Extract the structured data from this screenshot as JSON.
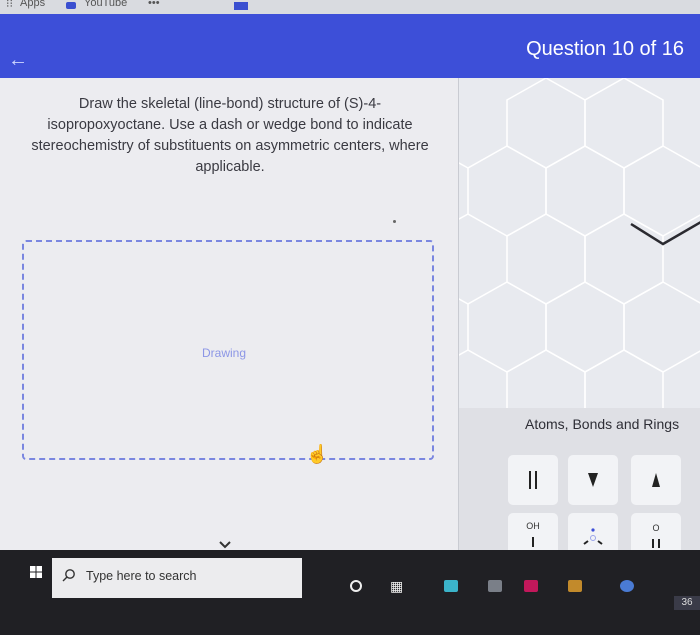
{
  "browser": {
    "bookmarks": [
      "Apps",
      "YouTube",
      "•••"
    ]
  },
  "header": {
    "question_counter": "Question 10 of 16"
  },
  "question": {
    "text": "Draw the skeletal (line-bond) structure of (S)-4-isopropoxyoctane. Use a dash or wedge bond to indicate stereochemistry of substituents on asymmetric centers, where applicable.",
    "drawing_label": "Drawing"
  },
  "tools": {
    "title": "Atoms, Bonds and Rings",
    "oh_label": "OH",
    "o_label": "O"
  },
  "taskbar": {
    "search_placeholder": "Type here to search",
    "time_partial": "36"
  },
  "colors": {
    "header": "#3d4fd8",
    "drawing_border": "#7a86e0",
    "taskbar": "#202024"
  }
}
